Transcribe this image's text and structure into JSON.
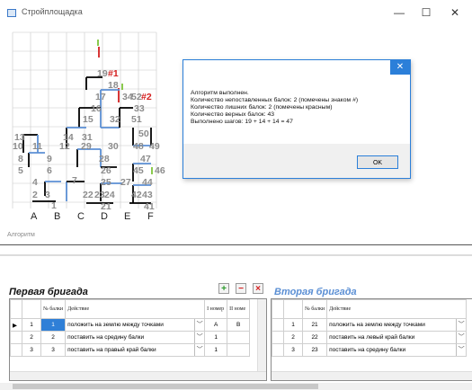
{
  "window": {
    "title": "Стройплощадка",
    "minimize": "—",
    "maximize": "☐",
    "close": "✕"
  },
  "canvas": {
    "numbers": [
      {
        "t": "19",
        "c": "gray"
      },
      {
        "t": "#1",
        "c": "red"
      },
      {
        "t": "18",
        "c": "gray"
      },
      {
        "t": "17",
        "c": "gray"
      },
      {
        "t": "34",
        "c": "gray"
      },
      {
        "t": "52",
        "c": "gray"
      },
      {
        "t": "#2",
        "c": "red"
      },
      {
        "t": "16",
        "c": "gray"
      },
      {
        "t": "33",
        "c": "gray"
      },
      {
        "t": "15",
        "c": "gray"
      },
      {
        "t": "32",
        "c": "gray"
      },
      {
        "t": "51",
        "c": "gray"
      },
      {
        "t": "13",
        "c": "gray"
      },
      {
        "t": "14",
        "c": "gray"
      },
      {
        "t": "31",
        "c": "gray"
      },
      {
        "t": "50",
        "c": "gray"
      },
      {
        "t": "10",
        "c": "gray"
      },
      {
        "t": "11",
        "c": "gray"
      },
      {
        "t": "12",
        "c": "gray"
      },
      {
        "t": "29",
        "c": "gray"
      },
      {
        "t": "30",
        "c": "gray"
      },
      {
        "t": "48",
        "c": "gray"
      },
      {
        "t": "49",
        "c": "gray"
      },
      {
        "t": "8",
        "c": "gray"
      },
      {
        "t": "9",
        "c": "gray"
      },
      {
        "t": "28",
        "c": "gray"
      },
      {
        "t": "47",
        "c": "gray"
      },
      {
        "t": "5",
        "c": "gray"
      },
      {
        "t": "6",
        "c": "gray"
      },
      {
        "t": "26",
        "c": "gray"
      },
      {
        "t": "45",
        "c": "gray"
      },
      {
        "t": "46",
        "c": "gray"
      },
      {
        "t": "4",
        "c": "gray"
      },
      {
        "t": "7",
        "c": "gray"
      },
      {
        "t": "25",
        "c": "gray"
      },
      {
        "t": "27",
        "c": "gray"
      },
      {
        "t": "44",
        "c": "gray"
      },
      {
        "t": "2",
        "c": "gray"
      },
      {
        "t": "3",
        "c": "gray"
      },
      {
        "t": "22",
        "c": "gray"
      },
      {
        "t": "23",
        "c": "gray"
      },
      {
        "t": "24",
        "c": "gray"
      },
      {
        "t": "42",
        "c": "gray"
      },
      {
        "t": "43",
        "c": "gray"
      },
      {
        "t": "1",
        "c": "gray"
      },
      {
        "t": "21",
        "c": "gray"
      },
      {
        "t": "41",
        "c": "gray"
      }
    ],
    "axis_letters": [
      "A",
      "B",
      "C",
      "D",
      "E",
      "F"
    ],
    "colors": {
      "black": "#000000",
      "blue": "#5b8fd4",
      "red": "#d42020",
      "green": "#7ec43a",
      "gray_text": "#8c8c8c",
      "red_text": "#d42020",
      "grid": "#c8c8c8"
    }
  },
  "algo": {
    "label": "Алгоритм"
  },
  "brigade1": {
    "title": "Первая бригада",
    "headers": {
      "num": "№ балки",
      "action": "Действие",
      "n1": "I номер",
      "n2": "II номе"
    },
    "rows": [
      {
        "idx": "1",
        "num": "1",
        "action": "положить на землю между точками",
        "n1": "A",
        "n2": "B"
      },
      {
        "idx": "2",
        "num": "2",
        "action": "поставить на средину балки",
        "n1": "1",
        "n2": ""
      },
      {
        "idx": "3",
        "num": "3",
        "action": "поставить на правый край балки",
        "n1": "1",
        "n2": ""
      }
    ],
    "buttons": {
      "add": "+",
      "remove": "−",
      "clear": "×"
    }
  },
  "brigade2": {
    "title": "Вторая бригада",
    "headers": {
      "num": "№ балки",
      "action": "Действие"
    },
    "rows": [
      {
        "idx": "1",
        "num": "21",
        "action": "положить на землю между точками"
      },
      {
        "idx": "2",
        "num": "22",
        "action": "поставить на левый край балки"
      },
      {
        "idx": "3",
        "num": "23",
        "action": "поставить на средину балки"
      }
    ]
  },
  "dialog": {
    "close": "✕",
    "lines": [
      "Алгоритм выполнен.",
      "Количество непоставленных балок: 2 (помечены знаком #)",
      "Количество лишних балок: 2 (помечены красным)",
      "Количество верных балок: 43",
      "Выполнено шагов: 19 + 14 + 14 = 47"
    ],
    "ok": "OK"
  }
}
